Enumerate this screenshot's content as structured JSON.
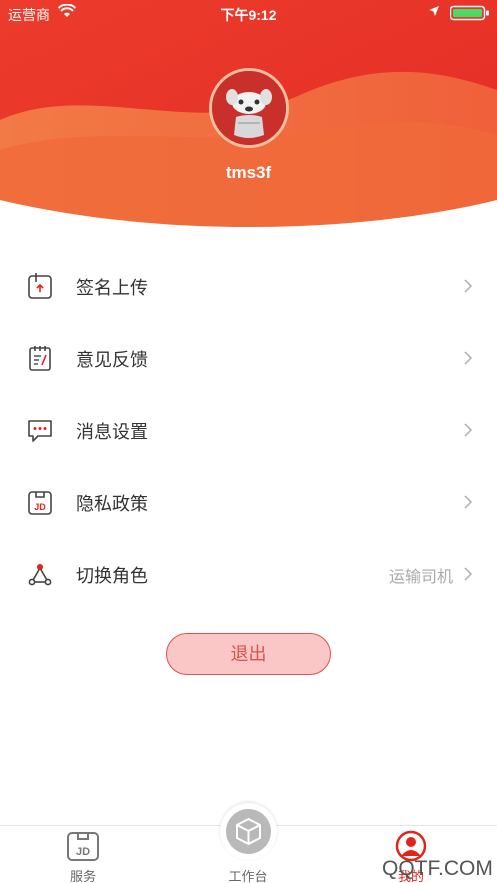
{
  "status_bar": {
    "carrier": "运营商",
    "time": "下午9:12"
  },
  "profile": {
    "username": "tms3f"
  },
  "menu": [
    {
      "label": "签名上传",
      "icon": "signature-upload-icon"
    },
    {
      "label": "意见反馈",
      "icon": "feedback-notepad-icon"
    },
    {
      "label": "消息设置",
      "icon": "message-bubble-icon"
    },
    {
      "label": "隐私政策",
      "icon": "jd-privacy-icon"
    },
    {
      "label": "切换角色",
      "icon": "switch-role-icon",
      "value": "运输司机"
    }
  ],
  "logout_label": "退出",
  "tabbar": {
    "services": "服务",
    "workbench": "工作台",
    "me": "我的"
  },
  "watermark": "QQTF.COM",
  "colors": {
    "header_red": "#e8322b",
    "header_orange": "#f4703a",
    "logout_fill": "#fbc6c6",
    "accent": "#d9534f"
  }
}
